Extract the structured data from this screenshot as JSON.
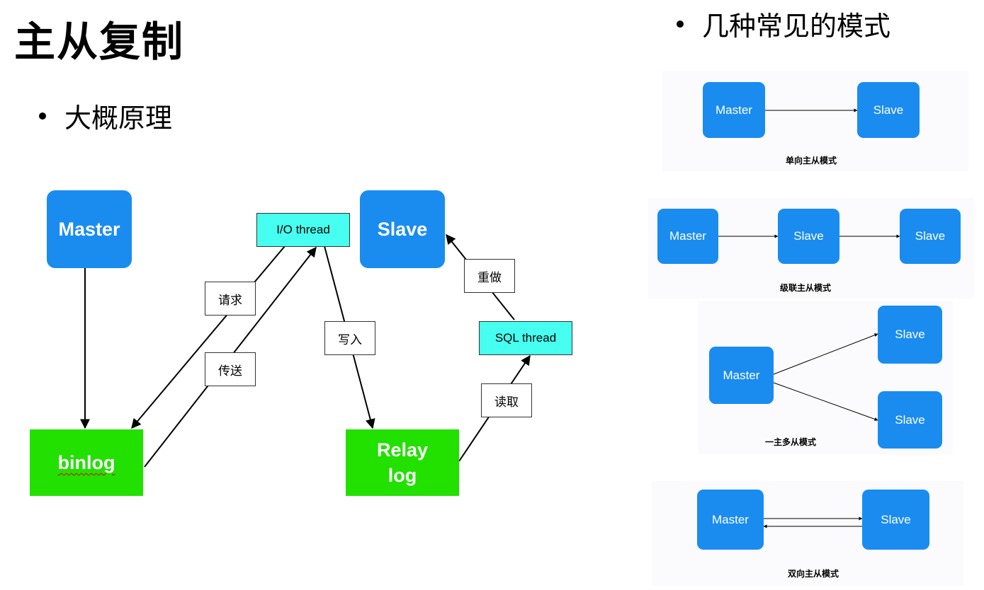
{
  "title": "主从复制",
  "left_section": {
    "bullet": "大概原理",
    "nodes": {
      "master": "Master",
      "slave": "Slave",
      "binlog": "binlog",
      "relay_log_line1": "Relay",
      "relay_log_line2": "log",
      "io_thread": "I/O thread",
      "sql_thread": "SQL thread"
    },
    "edge_labels": {
      "request": "请求",
      "transfer": "传送",
      "write": "写入",
      "redo": "重做",
      "read": "读取"
    }
  },
  "right_section": {
    "bullet": "几种常见的模式",
    "patterns": [
      {
        "caption": "单向主从模式",
        "nodes": [
          "Master",
          "Slave"
        ]
      },
      {
        "caption": "级联主从模式",
        "nodes": [
          "Master",
          "Slave",
          "Slave"
        ]
      },
      {
        "caption": "一主多从模式",
        "nodes": [
          "Master",
          "Slave",
          "Slave"
        ]
      },
      {
        "caption": "双向主从模式",
        "nodes": [
          "Master",
          "Slave"
        ]
      }
    ]
  },
  "colors": {
    "node_blue": "#1a8cf0",
    "node_green": "#22e000",
    "thread_cyan": "#47fff0"
  }
}
